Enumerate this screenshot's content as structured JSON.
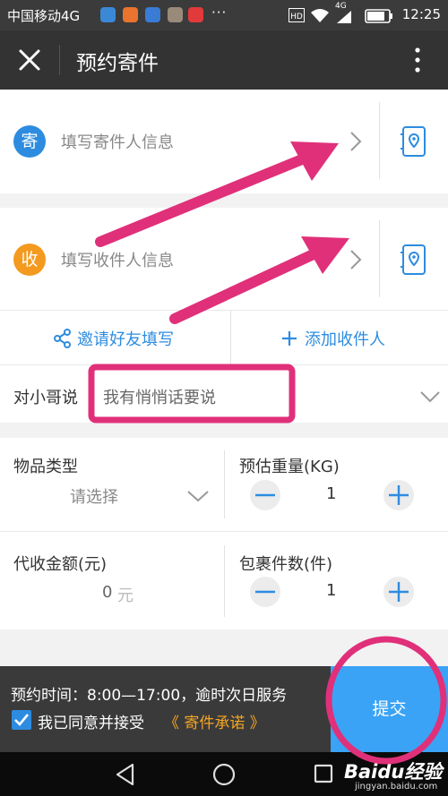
{
  "status_bar": {
    "carrier": "中国移动4G",
    "time": "12:25",
    "signal_label": "4G"
  },
  "header": {
    "title": "预约寄件"
  },
  "sender": {
    "badge": "寄",
    "placeholder": "填写寄件人信息"
  },
  "receiver": {
    "badge": "收",
    "placeholder": "填写收件人信息"
  },
  "actions": {
    "invite": "邀请好友填写",
    "add_receiver": "添加收件人"
  },
  "message": {
    "label": "对小哥说",
    "placeholder": "我有悄悄话要说"
  },
  "item_type": {
    "label": "物品类型",
    "value": "请选择"
  },
  "weight": {
    "label": "预估重量(KG)",
    "value": "1"
  },
  "cod": {
    "label": "代收金额(元)",
    "value": "0",
    "unit": "元"
  },
  "parcels": {
    "label": "包裹件数(件)",
    "value": "1"
  },
  "bottom": {
    "time_text": "预约时间：8:00—17:00，逾时次日服务",
    "agree_text": "我已同意并接受",
    "agreement_link": "《 寄件承诺 》",
    "submit": "提交"
  },
  "watermark": {
    "text": "Baidu经验",
    "url": "jingyan.baidu.com"
  },
  "colors": {
    "accent_blue": "#2d8ce0",
    "sender_badge": "#2d8ce0",
    "receiver_badge": "#f39a1f",
    "annotation": "#e0307a",
    "agreement_link": "#f5a623"
  }
}
